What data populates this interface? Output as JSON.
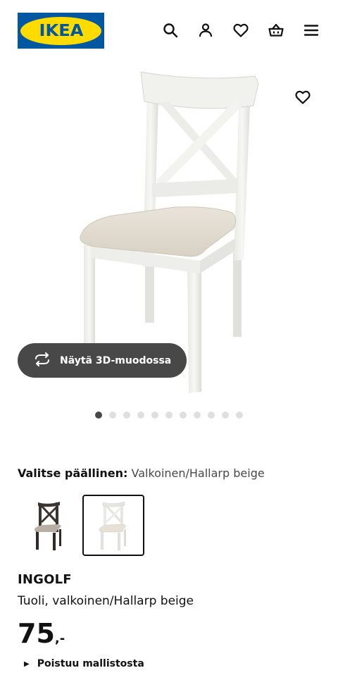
{
  "header": {
    "logo_text": "IKEA",
    "brand_colors": {
      "blue": "#0058a3",
      "yellow": "#ffdb00"
    },
    "icons": [
      "search-icon",
      "account-icon",
      "heart-icon",
      "basket-icon",
      "menu-icon"
    ]
  },
  "gallery": {
    "favourite_icon": "heart-icon",
    "view_3d_label": "Näytä 3D-muodossa",
    "view_3d_icon": "rotate-icon",
    "image_count": 11,
    "active_image": 1
  },
  "variant": {
    "label": "Valitse päällinen:",
    "selected_value": "Valkoinen/Hallarp beige",
    "options": [
      {
        "frame_color": "#3a3532",
        "seat_color": "#b8afa4"
      },
      {
        "frame_color": "#f2f2ef",
        "seat_color": "#e6e0d6",
        "selected": true
      }
    ]
  },
  "product": {
    "name": "INGOLF",
    "description": "Tuoli, valkoinen/Hallarp beige",
    "price_integer": "75",
    "price_suffix": ",-",
    "status": "Poistuu mallistosta"
  }
}
